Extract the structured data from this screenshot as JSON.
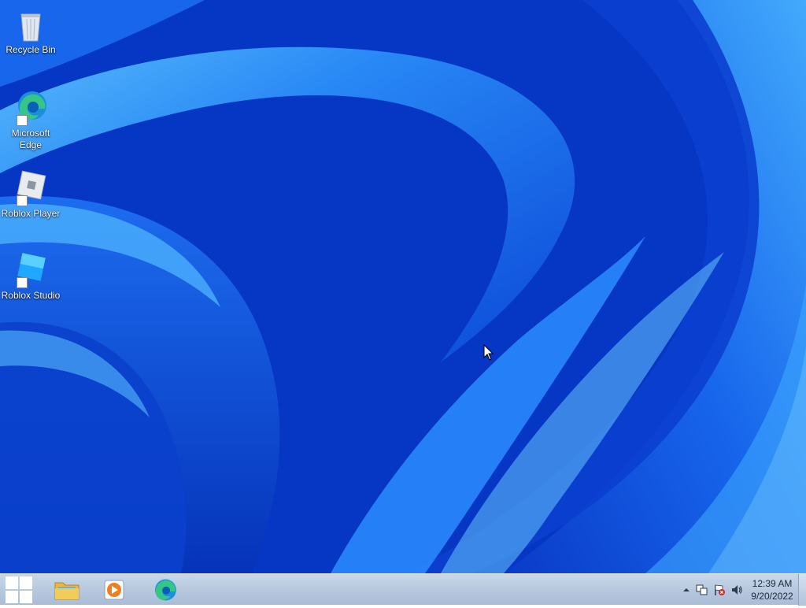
{
  "desktop": {
    "icons": [
      {
        "label": "Recycle Bin",
        "icon": "recycle-bin-icon"
      },
      {
        "label": "Microsoft Edge",
        "icon": "edge-icon"
      },
      {
        "label": "Roblox Player",
        "icon": "roblox-player-icon"
      },
      {
        "label": "Roblox Studio",
        "icon": "roblox-studio-icon"
      }
    ]
  },
  "taskbar": {
    "start_icon": "windows-start-icon",
    "pinned": [
      {
        "name": "File Explorer",
        "icon": "file-explorer-icon"
      },
      {
        "name": "Media Player",
        "icon": "media-player-icon"
      },
      {
        "name": "Microsoft Edge",
        "icon": "edge-icon"
      }
    ],
    "tray": {
      "icons": [
        "show-hidden-icons-chevron",
        "network-icon",
        "action-center-flag-icon",
        "volume-icon"
      ],
      "time": "12:39 AM",
      "date": "9/20/2022"
    }
  },
  "colors": {
    "wallpaper_base": "#0630c0",
    "wallpaper_highlight": "#3aa0ff",
    "taskbar": "#b7c9df",
    "clock_text": "#1b2a3c"
  }
}
